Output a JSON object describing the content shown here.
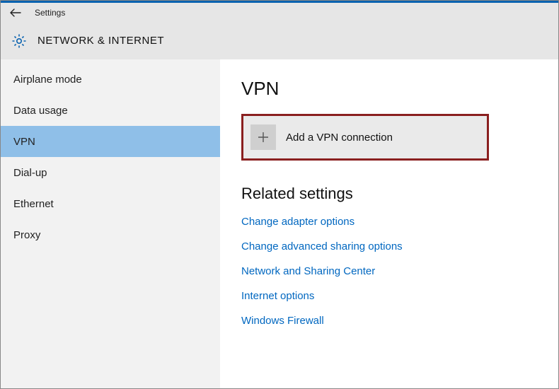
{
  "titlebar": {
    "label": "Settings"
  },
  "header": {
    "title": "NETWORK & INTERNET"
  },
  "sidebar": {
    "items": [
      {
        "label": "Airplane mode",
        "selected": false
      },
      {
        "label": "Data usage",
        "selected": false
      },
      {
        "label": "VPN",
        "selected": true
      },
      {
        "label": "Dial-up",
        "selected": false
      },
      {
        "label": "Ethernet",
        "selected": false
      },
      {
        "label": "Proxy",
        "selected": false
      }
    ]
  },
  "main": {
    "page_title": "VPN",
    "add_label": "Add a VPN connection",
    "related_title": "Related settings",
    "links": [
      "Change adapter options",
      "Change advanced sharing options",
      "Network and Sharing Center",
      "Internet options",
      "Windows Firewall"
    ]
  },
  "highlight_color": "#8a1f1f"
}
